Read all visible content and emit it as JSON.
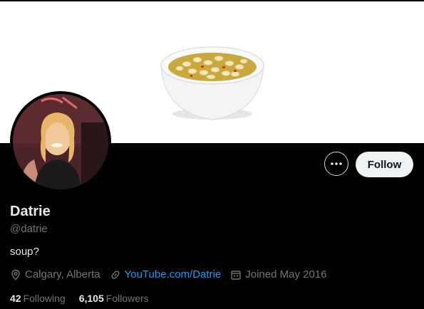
{
  "profile": {
    "name": "Datrie",
    "handle": "@datrie",
    "bio": "soup?",
    "location": "Calgary, Alberta",
    "website": "YouTube.com/Datrie",
    "joined": "Joined May 2016",
    "following_count": "42",
    "following_label": "Following",
    "followers_count": "6,105",
    "followers_label": "Followers"
  },
  "actions": {
    "follow_label": "Follow",
    "more_icon": "more-horizontal-icon"
  },
  "icons": {
    "location": "location-pin-icon",
    "link": "link-icon",
    "calendar": "calendar-icon"
  },
  "colors": {
    "background": "#000000",
    "link": "#1d9bf0",
    "secondary_text": "#71767b",
    "primary_text": "#e7e9ea",
    "follow_button_bg": "#eff3f4"
  }
}
